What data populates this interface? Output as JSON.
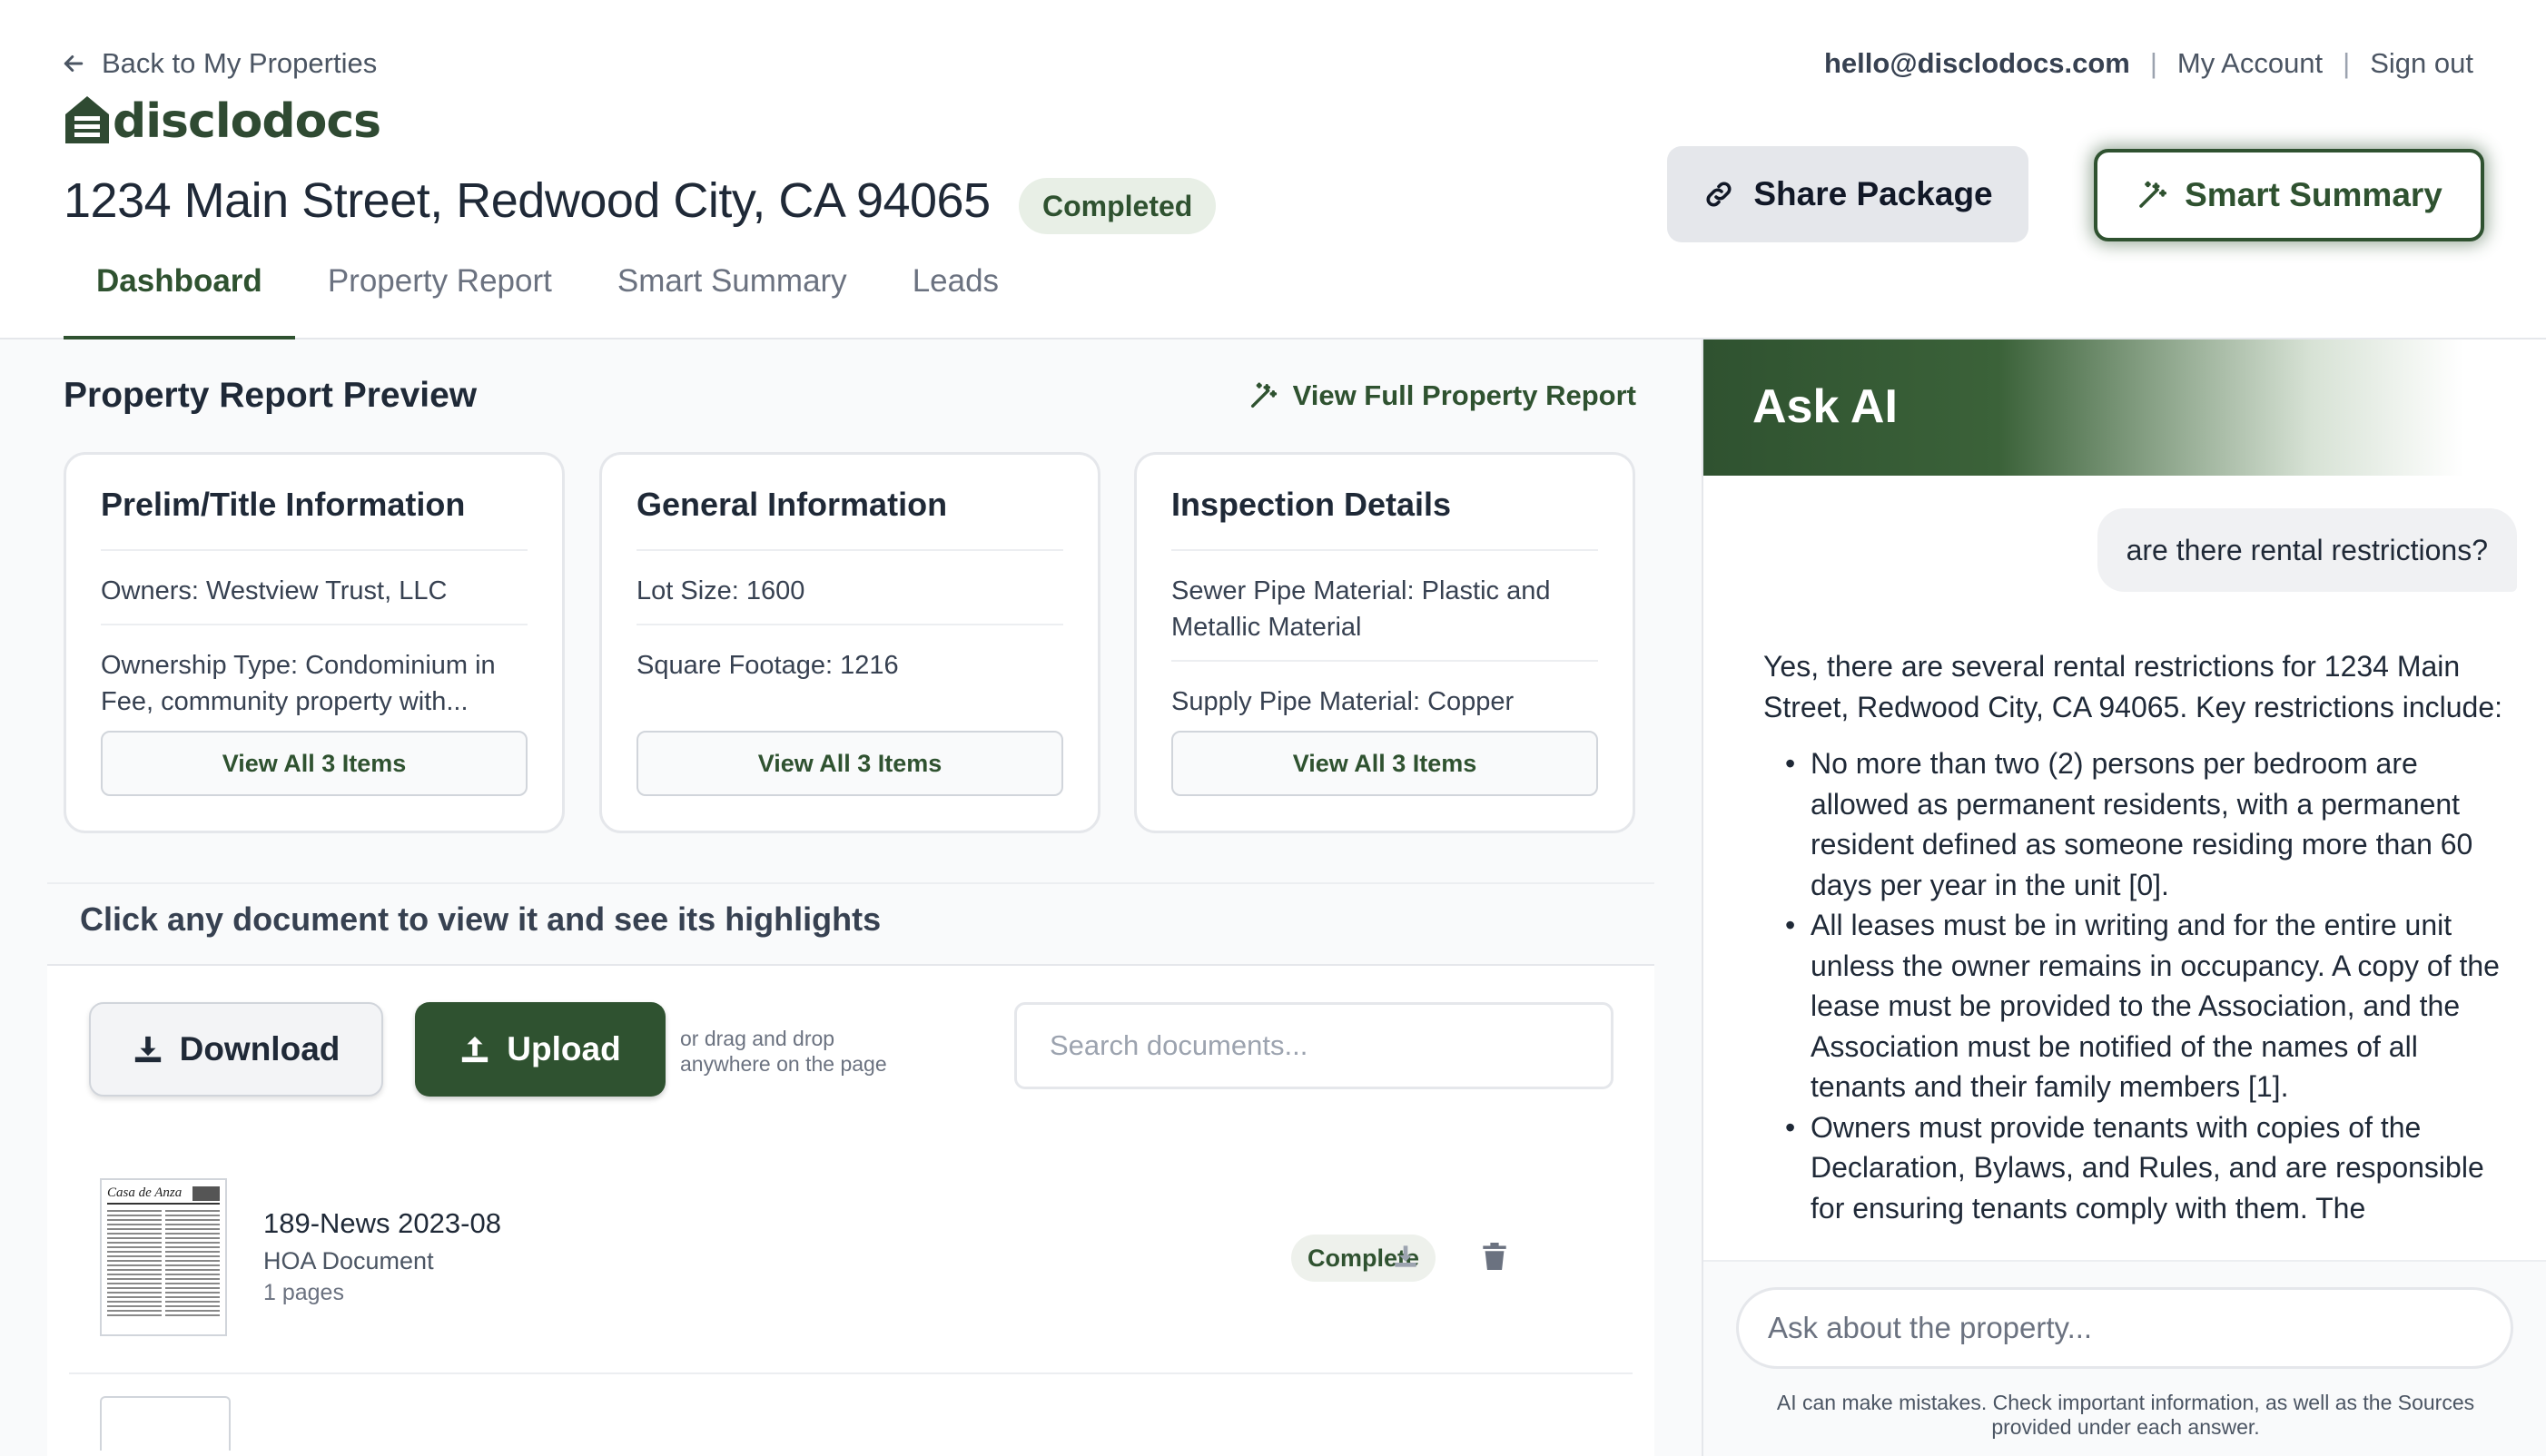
{
  "header": {
    "back_label": "Back to My Properties",
    "logo_text": "disclodocs",
    "account_email": "hello@disclodocs.com",
    "sep": "|",
    "my_account": "My Account",
    "sign_out": "Sign out",
    "address": "1234 Main Street, Redwood City, CA 94065",
    "status": "Completed",
    "share_label": "Share Package",
    "smart_summary_label": "Smart Summary"
  },
  "tabs": [
    {
      "label": "Dashboard",
      "active": true
    },
    {
      "label": "Property Report",
      "active": false
    },
    {
      "label": "Smart Summary",
      "active": false
    },
    {
      "label": "Leads",
      "active": false
    }
  ],
  "preview": {
    "title": "Property Report Preview",
    "view_full_label": "View Full Property Report",
    "cards": [
      {
        "title": "Prelim/Title Information",
        "rows": [
          "Owners: Westview Trust, LLC",
          "Ownership Type: Condominium in Fee, community property with..."
        ],
        "button": "View All 3 Items"
      },
      {
        "title": "General Information",
        "rows": [
          "Lot Size: 1600",
          "Square Footage: 1216"
        ],
        "button": "View All 3 Items"
      },
      {
        "title": "Inspection Details",
        "rows": [
          "Sewer Pipe Material: Plastic and Metallic Material",
          "Supply Pipe Material: Copper"
        ],
        "button": "View All 3 Items"
      }
    ]
  },
  "documents": {
    "header": "Click any document to view it and see its highlights",
    "download_label": "Download",
    "upload_label": "Upload",
    "drag_hint_line1": "or drag and drop",
    "drag_hint_line2": "anywhere on the page",
    "search_placeholder": "Search documents...",
    "items": [
      {
        "thumb_title": "Casa de Anza",
        "name": "189-News 2023-08",
        "type": "HOA Document",
        "pages": "1 pages",
        "status": "Complete"
      }
    ]
  },
  "ask_ai": {
    "title": "Ask AI",
    "user_question": "are there rental restrictions?",
    "answer_intro": "Yes, there are several rental restrictions for 1234 Main Street, Redwood City, CA 94065. Key restrictions include:",
    "answer_points": [
      "No more than two (2) persons per bedroom are allowed as permanent residents, with a permanent resident defined as someone residing more than 60 days per year in the unit [0].",
      "All leases must be in writing and for the entire unit unless the owner remains in occupancy. A copy of the lease must be provided to the Association, and the Association must be notified of the names of all tenants and their family members [1].",
      "Owners must provide tenants with copies of the Declaration, Bylaws, and Rules, and are responsible for ensuring tenants comply with them. The"
    ],
    "input_placeholder": "Ask about the property...",
    "disclaimer": "AI can make mistakes. Check important information, as well as the Sources provided under each answer."
  },
  "colors": {
    "brand_green": "#2f5230",
    "pill_bg": "#e8efe6",
    "panel_bg": "#f9fafb"
  },
  "icons": [
    "arrow-left-icon",
    "house-logo-icon",
    "link-icon",
    "magic-wand-icon",
    "download-icon",
    "upload-icon",
    "trash-icon"
  ]
}
